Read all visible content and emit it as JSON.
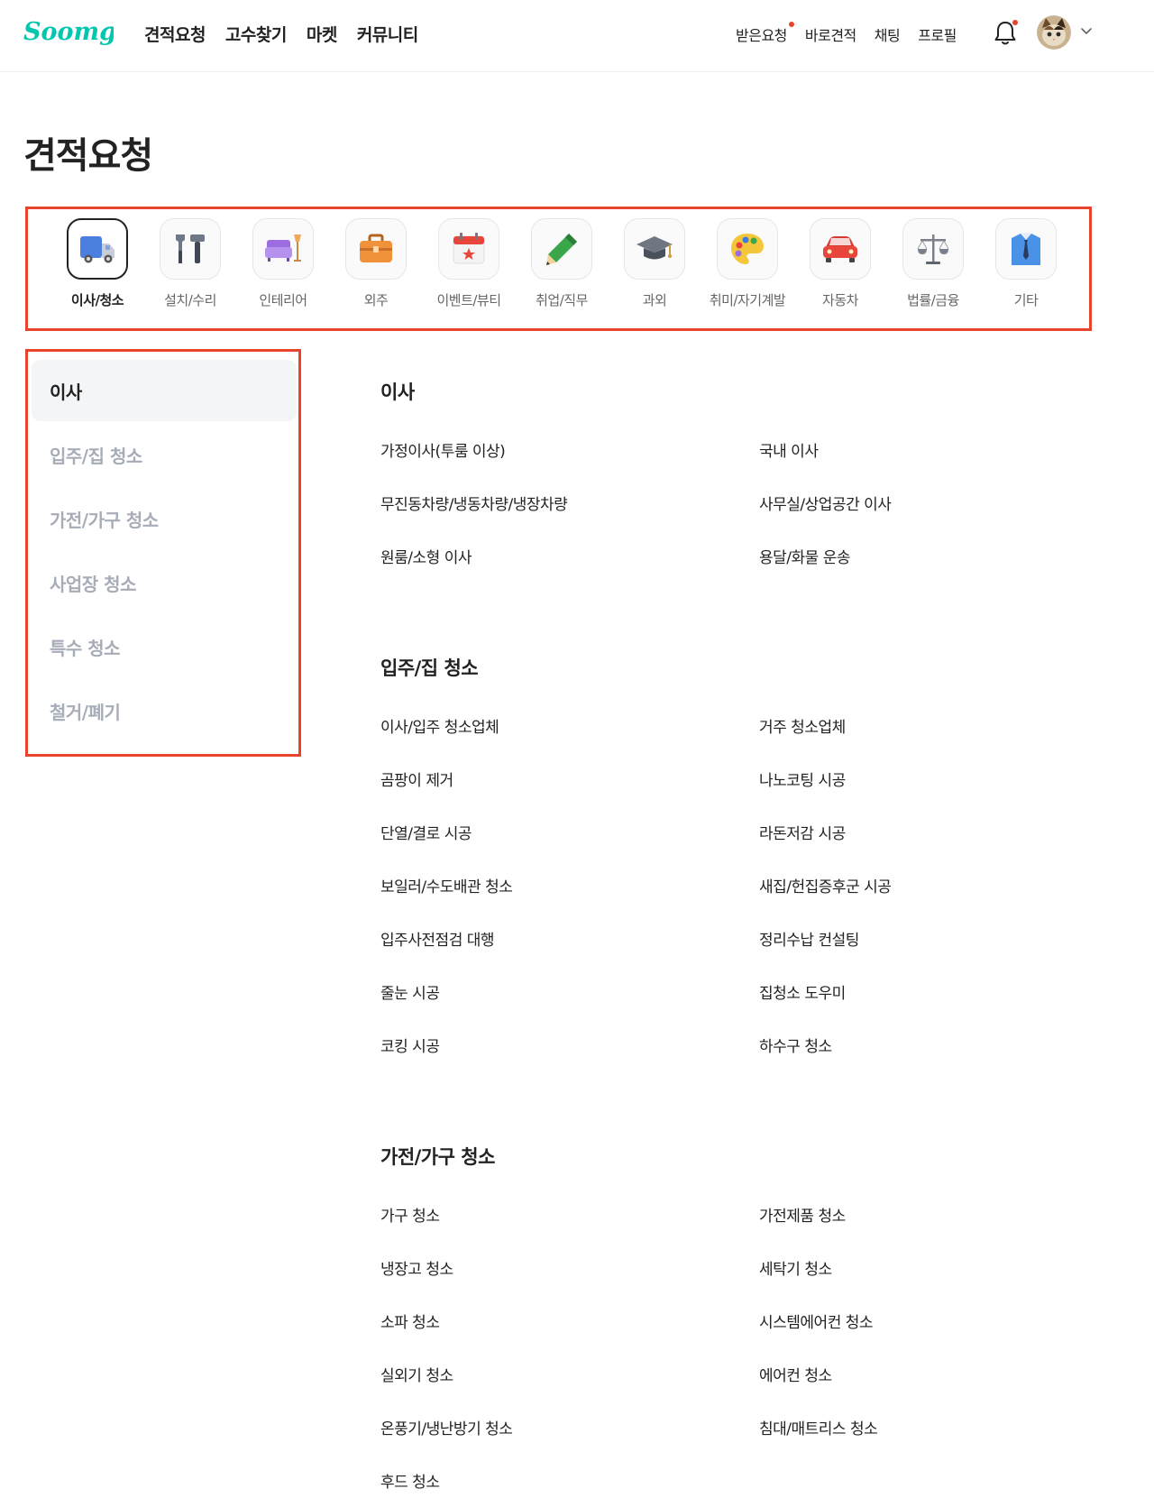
{
  "header": {
    "logo_text": "Soomgo",
    "main_nav": [
      "견적요청",
      "고수찾기",
      "마켓",
      "커뮤니티"
    ],
    "util_nav": {
      "received": "받은요청",
      "quick_quote": "바로견적",
      "chat": "채팅",
      "profile": "프로필"
    }
  },
  "page": {
    "title": "견적요청"
  },
  "colors": {
    "brand": "#00c7ae",
    "highlight": "#e8432d",
    "muted": "#a7adb7"
  },
  "categories": [
    {
      "label": "이사/청소",
      "icon": "truck-icon"
    },
    {
      "label": "설치/수리",
      "icon": "tools-icon"
    },
    {
      "label": "인테리어",
      "icon": "sofa-lamp-icon"
    },
    {
      "label": "외주",
      "icon": "briefcase-icon"
    },
    {
      "label": "이벤트/뷰티",
      "icon": "calendar-star-icon"
    },
    {
      "label": "취업/직무",
      "icon": "pencil-icon"
    },
    {
      "label": "과외",
      "icon": "graduation-cap-icon"
    },
    {
      "label": "취미/자기계발",
      "icon": "palette-icon"
    },
    {
      "label": "자동차",
      "icon": "car-icon"
    },
    {
      "label": "법률/금융",
      "icon": "scales-icon"
    },
    {
      "label": "기타",
      "icon": "shirt-tie-icon"
    }
  ],
  "sidebar": [
    "이사",
    "입주/집 청소",
    "가전/가구 청소",
    "사업장 청소",
    "특수 청소",
    "철거/폐기"
  ],
  "sections": [
    {
      "title": "이사",
      "items": [
        "가정이사(투룸 이상)",
        "국내 이사",
        "무진동차량/냉동차량/냉장차량",
        "사무실/상업공간 이사",
        "원룸/소형 이사",
        "용달/화물 운송"
      ]
    },
    {
      "title": "입주/집 청소",
      "items": [
        "이사/입주 청소업체",
        "거주 청소업체",
        "곰팡이 제거",
        "나노코팅 시공",
        "단열/결로 시공",
        "라돈저감 시공",
        "보일러/수도배관 청소",
        "새집/헌집증후군 시공",
        "입주사전점검 대행",
        "정리수납 컨설팅",
        "줄눈 시공",
        "집청소 도우미",
        "코킹 시공",
        "하수구 청소"
      ]
    },
    {
      "title": "가전/가구 청소",
      "items": [
        "가구 청소",
        "가전제품 청소",
        "냉장고 청소",
        "세탁기 청소",
        "소파 청소",
        "시스템에어컨 청소",
        "실외기 청소",
        "에어컨 청소",
        "온풍기/냉난방기 청소",
        "침대/매트리스 청소",
        "후드 청소"
      ]
    }
  ]
}
